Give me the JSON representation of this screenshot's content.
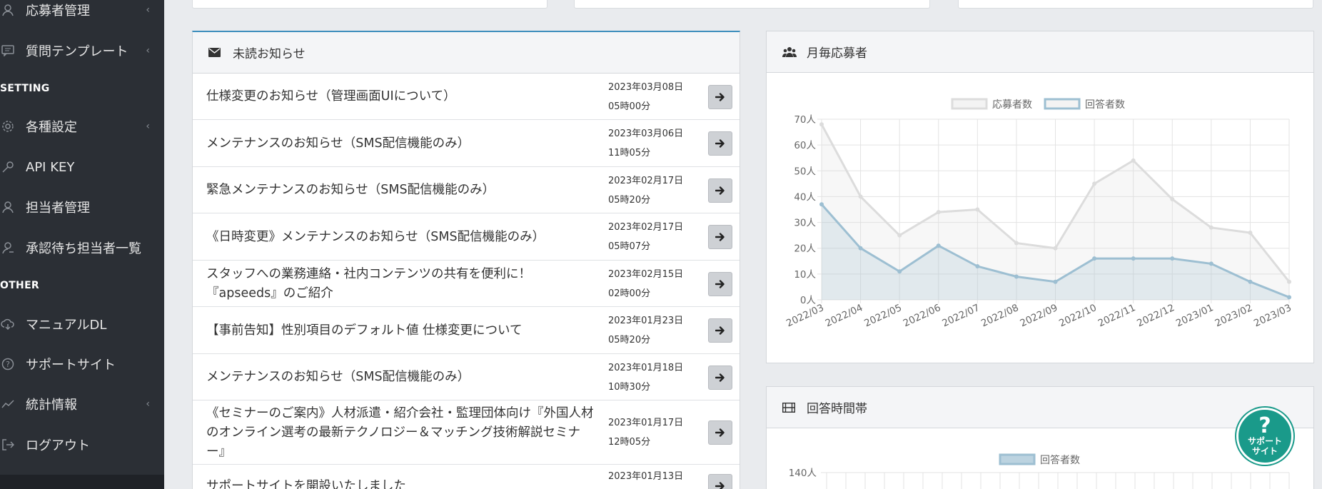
{
  "sidebar": {
    "items": [
      {
        "label": "応募者管理",
        "icon": "person-icon",
        "chevron": "‹"
      },
      {
        "label": "質問テンプレート",
        "icon": "chat-icon",
        "chevron": "‹"
      },
      {
        "label": "各種設定",
        "icon": "gear-icon",
        "chevron": "‹"
      },
      {
        "label": "API KEY",
        "icon": "key-icon",
        "chevron": ""
      },
      {
        "label": "担当者管理",
        "icon": "user-icon",
        "chevron": ""
      },
      {
        "label": "承認待ち担当者一覧",
        "icon": "user-pending-icon",
        "chevron": ""
      },
      {
        "label": "マニュアルDL",
        "icon": "cloud-download-icon",
        "chevron": ""
      },
      {
        "label": "サポートサイト",
        "icon": "question-circle-icon",
        "chevron": ""
      },
      {
        "label": "統計情報",
        "icon": "line-chart-icon",
        "chevron": "‹"
      },
      {
        "label": "ログアウト",
        "icon": "logout-icon",
        "chevron": ""
      }
    ],
    "headers": {
      "setting": "SETTING",
      "other": "OTHER"
    }
  },
  "news": {
    "title": "未読お知らせ",
    "items": [
      {
        "lines": [
          "仕様変更のお知らせ（管理画面UIについて）"
        ],
        "date": "2023年03月08日",
        "time": "05時00分"
      },
      {
        "lines": [
          "メンテナンスのお知らせ（SMS配信機能のみ）"
        ],
        "date": "2023年03月06日",
        "time": "11時05分"
      },
      {
        "lines": [
          "緊急メンテナンスのお知らせ（SMS配信機能のみ）"
        ],
        "date": "2023年02月17日",
        "time": "05時20分"
      },
      {
        "lines": [
          "《日時変更》メンテナンスのお知らせ（SMS配信機能のみ）"
        ],
        "date": "2023年02月17日",
        "time": "05時07分"
      },
      {
        "lines": [
          "スタッフへの業務連絡・社内コンテンツの共有を便利に！",
          "『apseeds』のご紹介"
        ],
        "date": "2023年02月15日",
        "time": "02時00分"
      },
      {
        "lines": [
          "【事前告知】性別項目のデフォルト値 仕様変更について"
        ],
        "date": "2023年01月23日",
        "time": "05時20分"
      },
      {
        "lines": [
          "メンテナンスのお知らせ（SMS配信機能のみ）"
        ],
        "date": "2023年01月18日",
        "time": "10時30分"
      },
      {
        "lines": [
          "《セミナーのご案内》人材派遣・紹介会社・監理団体向け『外国人材",
          "のオンライン選考の最新テクノロジー＆マッチング技術解説セミナ",
          "ー』"
        ],
        "date": "2023年01月17日",
        "time": "12時05分"
      },
      {
        "lines": [
          "サポートサイトを開設いたしました"
        ],
        "date": "2023年01月13日",
        "time": ""
      }
    ]
  },
  "monthly": {
    "title": "月毎応募者"
  },
  "chart_data": [
    {
      "type": "line",
      "x": [
        "2022/03",
        "2022/04",
        "2022/05",
        "2022/06",
        "2022/07",
        "2022/08",
        "2022/09",
        "2022/10",
        "2022/11",
        "2022/12",
        "2023/01",
        "2023/02",
        "2023/03"
      ],
      "series": [
        {
          "name": "応募者数",
          "values": [
            68,
            40,
            25,
            34,
            35,
            22,
            20,
            45,
            54,
            39,
            28,
            26,
            7
          ],
          "color": "#dcdcdc"
        },
        {
          "name": "回答者数",
          "values": [
            37,
            20,
            11,
            21,
            13,
            9,
            7,
            16,
            16,
            16,
            14,
            7,
            1
          ],
          "color": "#9dbfd2"
        }
      ],
      "y_ticks": [
        "0人",
        "10人",
        "20人",
        "30人",
        "40人",
        "50人",
        "60人",
        "70人"
      ],
      "ylim": [
        0,
        70
      ],
      "grid": true,
      "legend": "top-center"
    },
    {
      "type": "bar",
      "series": [
        {
          "name": "回答者数",
          "values": []
        }
      ],
      "y_ticks": [
        "140人"
      ],
      "legend": "top-center"
    }
  ],
  "response_time": {
    "title": "回答時間帯"
  },
  "support_badge": {
    "q": "?",
    "line1": "サポート",
    "line2": "サイト"
  }
}
